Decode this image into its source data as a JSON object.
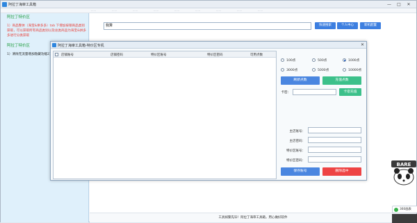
{
  "window": {
    "title": "阿拉丁海审工具箱",
    "minimize": "—",
    "maximize": "□",
    "close": "✕"
  },
  "menubar": [
    "……",
    "……",
    "……",
    "……",
    "……",
    "……",
    "……",
    "……",
    "……"
  ],
  "left_panel": {
    "heading1": "阿拉丁特价区",
    "tip1": "1）商品整体（海宝&拼多多）tab 下增加按钢商品类别获取，可以获取所有商品类别以及总类商品为海宝&拼多多进行分类获取",
    "heading2": "阿拉丁特价区",
    "tip2": "1）清除无流量增加隐藏功能2）清除无流量增加隐",
    "tip2b": "能2）清除无流量增加隐"
  },
  "main": {
    "search_value": "我算",
    "buttons": [
      "快速搜索",
      "个人中心",
      "新机配置"
    ],
    "footer": "工具如繁先毕！阿拉丁海审工具箱，用心做好软件"
  },
  "dialog": {
    "title": "阿拉丁海审工具箱-特价区专机",
    "close": "✕",
    "grid_columns": [
      "店铺账号",
      "店铺密码",
      "特价区账号",
      "特价区密码",
      "可用点数"
    ],
    "radio_options": [
      "100点",
      "500点",
      "1000点",
      "3000点",
      "5000点",
      "10000点"
    ],
    "selected_option": "1000点",
    "refresh_btn": "刷新点数",
    "recharge_btn": "充值点数",
    "card_label": "卡密：",
    "card_value": "",
    "card_recharge_btn": "卡密充值",
    "fields": [
      {
        "label": "主店账号：",
        "value": ""
      },
      {
        "label": "主店密码：",
        "value": ""
      },
      {
        "label": "特价区账号：",
        "value": ""
      },
      {
        "label": "特价区密码：",
        "value": ""
      }
    ],
    "save_btn": "保存账号",
    "delete_btn": "删除选中"
  },
  "tray": {
    "popup_text": "360画表",
    "mascot_text": "BARE"
  },
  "colors": {
    "accent_blue": "#3d7fe0",
    "green": "#3cc08a",
    "red": "#ee4444",
    "heading_green": "#1a9a3a",
    "tip_red": "#e8423b"
  }
}
